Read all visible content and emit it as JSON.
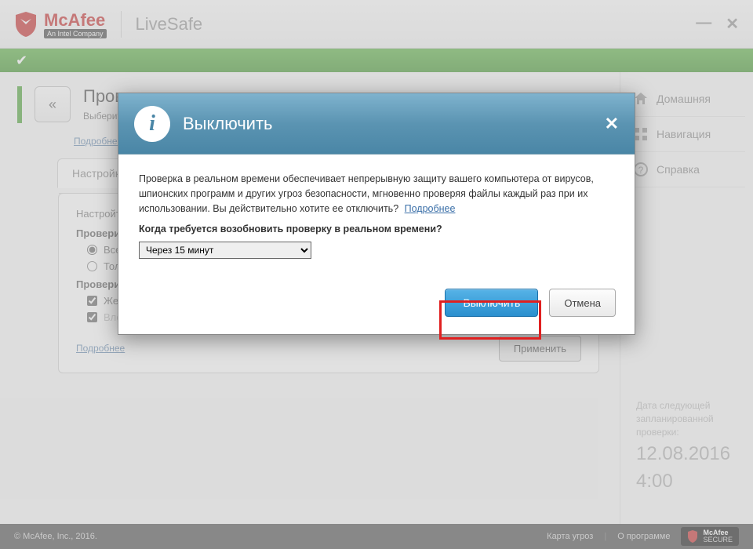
{
  "header": {
    "brand": "McAfee",
    "tagline": "An Intel Company",
    "product": "LiveSafe"
  },
  "sidebar": {
    "items": [
      {
        "label": "Домашняя"
      },
      {
        "label": "Навигация"
      },
      {
        "label": "Справка"
      }
    ],
    "nextScan": {
      "label": "Дата следующей запланированной проверки:",
      "date": "12.08.2016",
      "time": "4:00"
    }
  },
  "page": {
    "title": "Проверка",
    "subtitle": "Выберите типы файлов для проверки в реальном времени, а также угрозы...",
    "moreLink": "Подробнее",
    "settingsTab": "Настройки",
    "settingsPrompt": "Настройте параметры",
    "group1": "Проверить",
    "opt1": "Все файлы (рекомендуется)",
    "opt2": "Только программы и документы",
    "group2": "Проверить эти вложения и расположения",
    "opt3": "Жесткие диски ПК (автоматически)",
    "opt4": "Вложения электронной почты",
    "applyBtn": "Применить",
    "panelMore": "Подробнее"
  },
  "modal": {
    "title": "Выключить",
    "body": "Проверка в реальном времени обеспечивает непрерывную защиту вашего компьютера от вирусов, шпионских программ и других угроз безопасности, мгновенно проверяя файлы каждый раз при их использовании. Вы действительно хотите ее отключить?",
    "moreLink": "Подробнее",
    "question": "Когда требуется возобновить проверку в реальном времени?",
    "selectValue": "Через 15 минут",
    "primaryBtn": "Выключить",
    "cancelBtn": "Отмена"
  },
  "footer": {
    "copyright": "© McAfee, Inc., 2016.",
    "link1": "Карта угроз",
    "link2": "О программе",
    "secure": "McAfee SECURE"
  }
}
